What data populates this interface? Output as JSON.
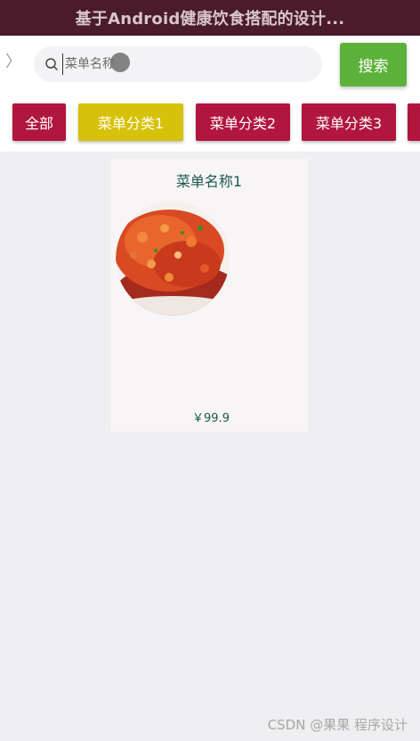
{
  "app": {
    "title": "基于Android健康饮食搭配的设计..."
  },
  "search": {
    "back_icon": "chevron-left-icon",
    "search_icon": "search-icon",
    "placeholder": "菜单名称",
    "value": "",
    "button_label": "搜索"
  },
  "categories": [
    {
      "label": "全部",
      "active": false
    },
    {
      "label": "菜单分类1",
      "active": true
    },
    {
      "label": "菜单分类2",
      "active": false
    },
    {
      "label": "菜单分类3",
      "active": false
    }
  ],
  "items": [
    {
      "name": "菜单名称1",
      "price": "￥99.9"
    }
  ],
  "colors": {
    "title_bar": "#4a1b2a",
    "category": "#b0163e",
    "category_active": "#d6c20a",
    "search_button": "#5cb13a",
    "item_text": "#1a5a50"
  },
  "watermark": "CSDN @果果 程序设计"
}
